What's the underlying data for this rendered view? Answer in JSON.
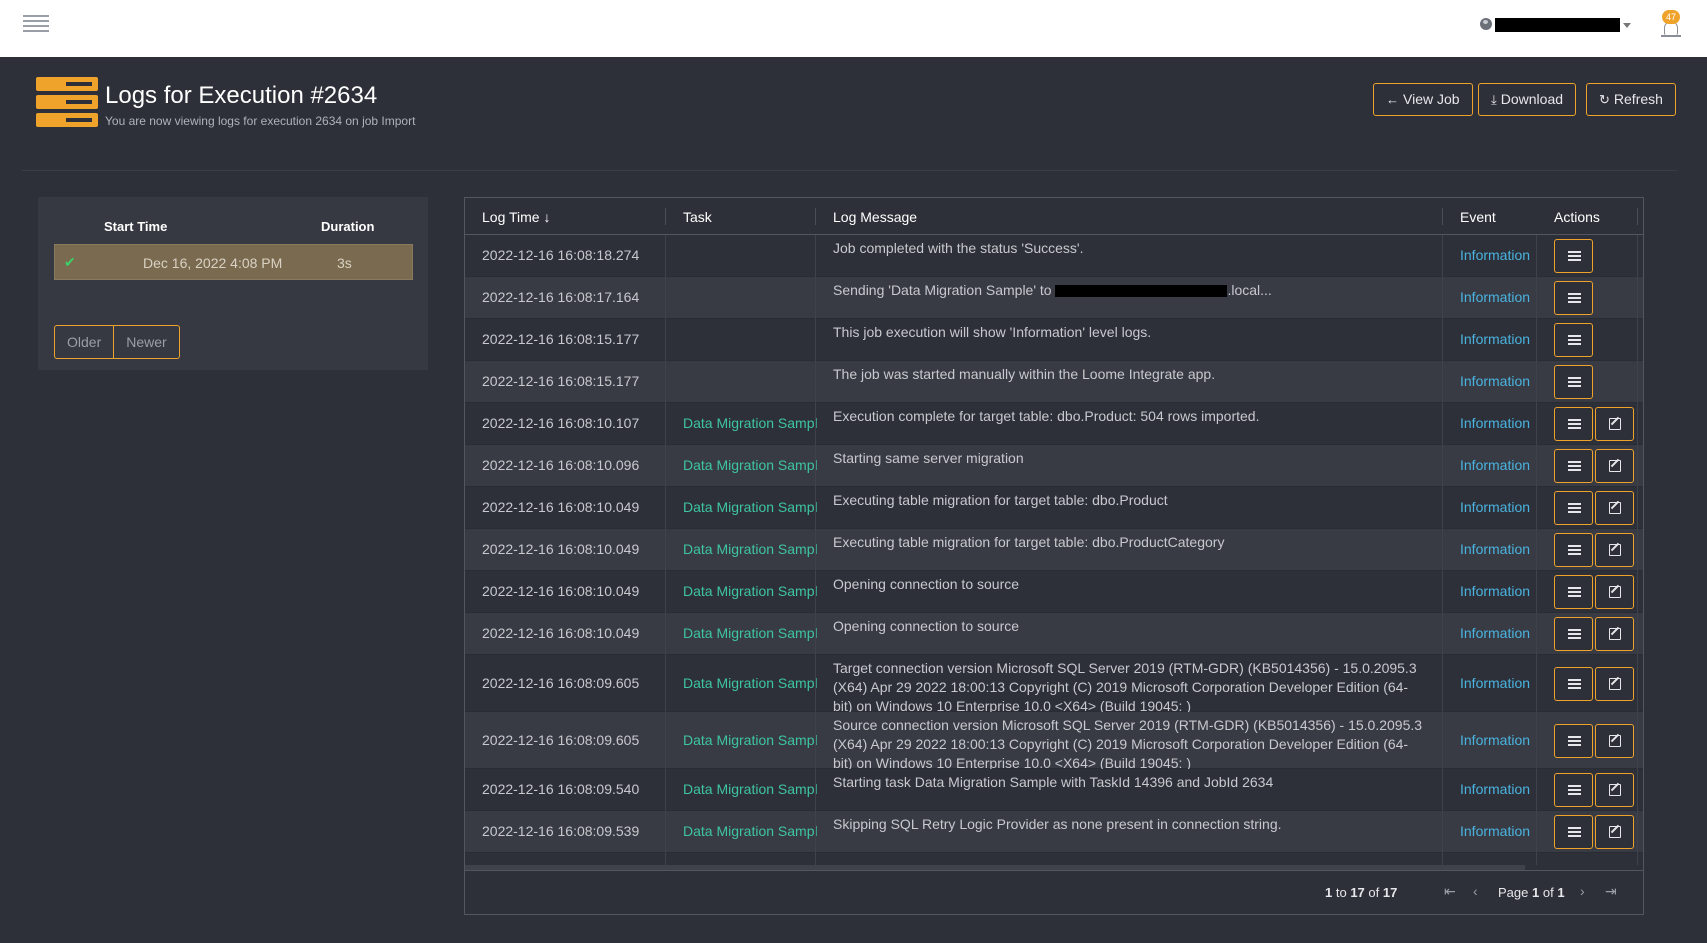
{
  "topbar": {
    "notification_count": "47"
  },
  "header": {
    "title": "Logs for Execution #2634",
    "subtitle": "You are now viewing logs for execution 2634 on job Import",
    "buttons": {
      "view_job": "View Job",
      "download": "Download",
      "refresh": "Refresh"
    }
  },
  "executions": {
    "col_start": "Start Time",
    "col_duration": "Duration",
    "rows": [
      {
        "start": "Dec 16, 2022 4:08 PM",
        "duration": "3s"
      }
    ],
    "older": "Older",
    "newer": "Newer"
  },
  "grid": {
    "columns": {
      "time": "Log Time",
      "task": "Task",
      "message": "Log Message",
      "event": "Event",
      "actions": "Actions"
    },
    "rows": [
      {
        "time": "2022-12-16 16:08:18.274",
        "task": "",
        "message": "Job completed with the status 'Success'.",
        "event": "Information"
      },
      {
        "time": "2022-12-16 16:08:17.164",
        "task": "",
        "message_pre": "Sending 'Data Migration Sample' to ",
        "message_post": ".local...",
        "event": "Information"
      },
      {
        "time": "2022-12-16 16:08:15.177",
        "task": "",
        "message": "This job execution will show 'Information' level logs.",
        "event": "Information"
      },
      {
        "time": "2022-12-16 16:08:15.177",
        "task": "",
        "message": "The job was started manually within the Loome Integrate app.",
        "event": "Information"
      },
      {
        "time": "2022-12-16 16:08:10.107",
        "task": "Data Migration Sample",
        "message": "Execution complete for target table: dbo.Product: 504 rows imported.",
        "event": "Information"
      },
      {
        "time": "2022-12-16 16:08:10.096",
        "task": "Data Migration Sample",
        "message": "Starting same server migration",
        "event": "Information"
      },
      {
        "time": "2022-12-16 16:08:10.049",
        "task": "Data Migration Sample",
        "message": "Executing table migration for target table: dbo.Product",
        "event": "Information"
      },
      {
        "time": "2022-12-16 16:08:10.049",
        "task": "Data Migration Sample",
        "message": "Executing table migration for target table: dbo.ProductCategory",
        "event": "Information"
      },
      {
        "time": "2022-12-16 16:08:10.049",
        "task": "Data Migration Sample",
        "message": "Opening connection to source",
        "event": "Information"
      },
      {
        "time": "2022-12-16 16:08:10.049",
        "task": "Data Migration Sample",
        "message": "Opening connection to source",
        "event": "Information"
      },
      {
        "time": "2022-12-16 16:08:09.605",
        "task": "Data Migration Sample",
        "message": "Target connection version Microsoft SQL Server 2019 (RTM-GDR) (KB5014356) - 15.0.2095.3 (X64) Apr 29 2022 18:00:13 Copyright (C) 2019 Microsoft Corporation Developer Edition (64-bit) on Windows 10 Enterprise 10.0 <X64> (Build 19045: )",
        "event": "Information"
      },
      {
        "time": "2022-12-16 16:08:09.605",
        "task": "Data Migration Sample",
        "message": "Source connection version Microsoft SQL Server 2019 (RTM-GDR) (KB5014356) - 15.0.2095.3 (X64) Apr 29 2022 18:00:13 Copyright (C) 2019 Microsoft Corporation Developer Edition (64-bit) on Windows 10 Enterprise 10.0 <X64> (Build 19045: )",
        "event": "Information"
      },
      {
        "time": "2022-12-16 16:08:09.540",
        "task": "Data Migration Sample",
        "message": "Starting task Data Migration Sample with TaskId 14396 and JobId 2634",
        "event": "Information"
      },
      {
        "time": "2022-12-16 16:08:09.539",
        "task": "Data Migration Sample",
        "message": "Skipping SQL Retry Logic Provider as none present in connection string.",
        "event": "Information"
      }
    ],
    "footer": {
      "from": "1",
      "to_word": "to",
      "to": "17",
      "of_word": "of",
      "total": "17",
      "page_word": "Page",
      "page": "1",
      "pages": "1"
    }
  },
  "colors": {
    "accent": "#f0a32b",
    "task": "#3ec5a0",
    "event": "#4ab3e0",
    "success": "#3ecf6a"
  }
}
